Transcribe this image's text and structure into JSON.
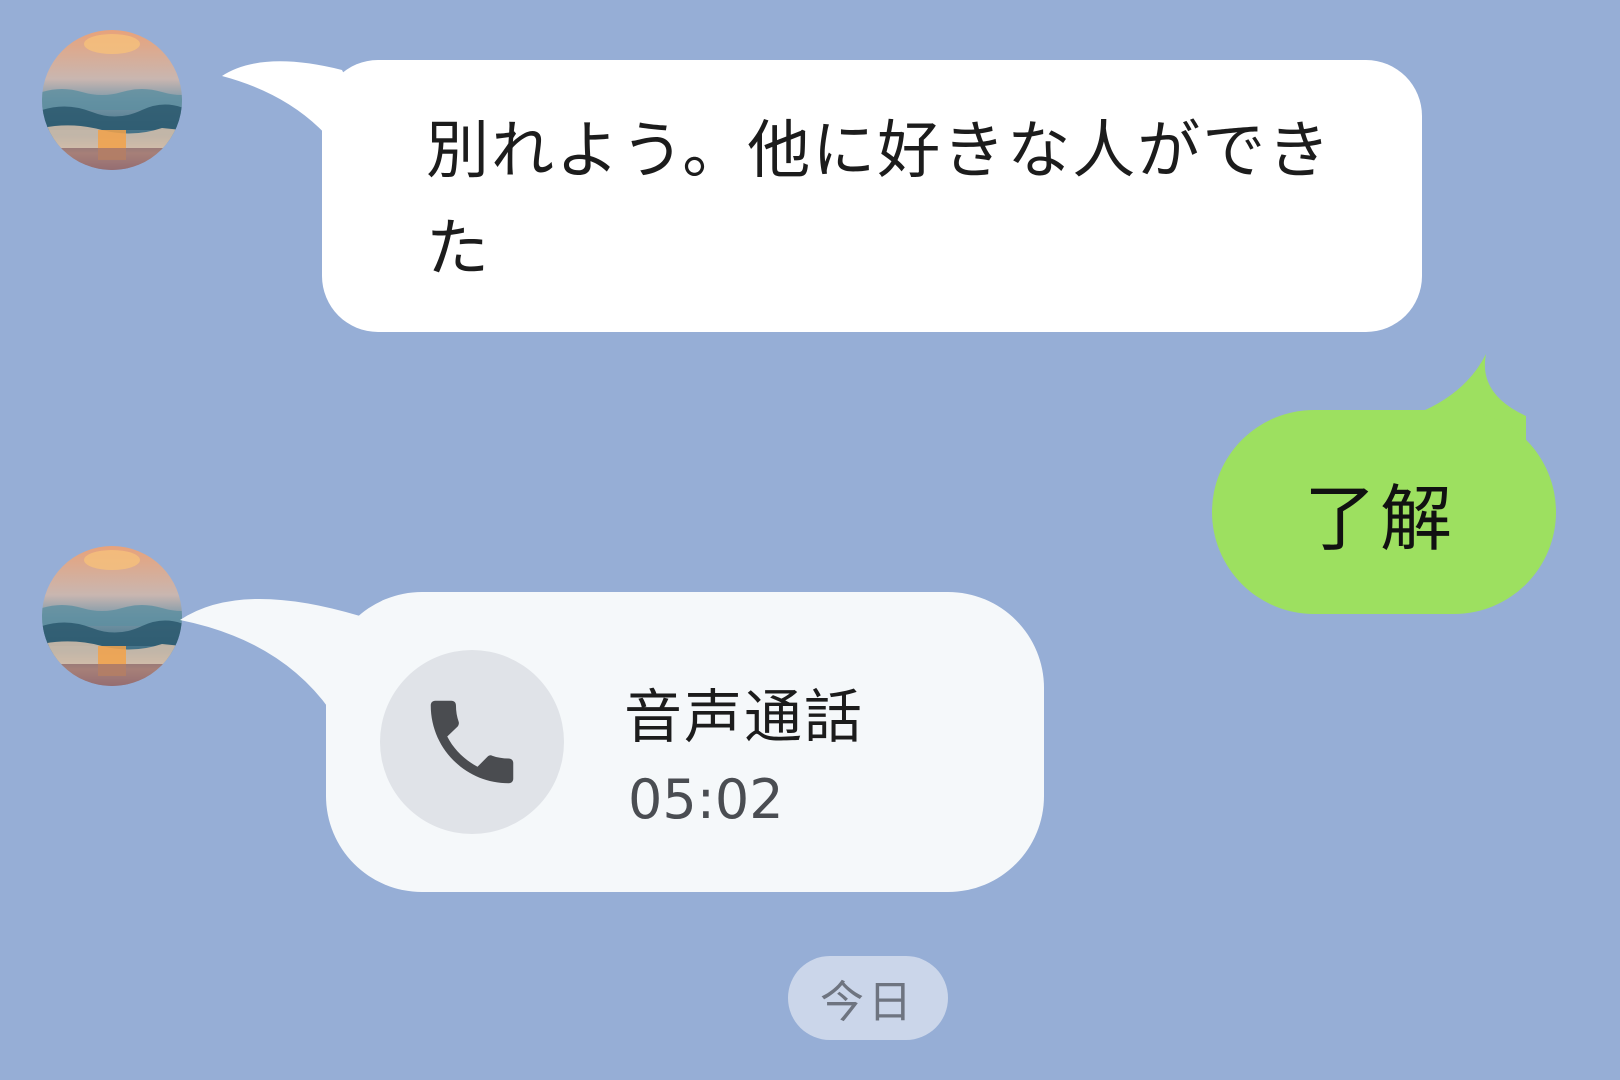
{
  "messages": [
    {
      "sender": "other",
      "avatar": "sunset-sea-avatar",
      "text": "別れよう。他に好きな人ができた"
    },
    {
      "sender": "me",
      "text": "了解"
    },
    {
      "sender": "other",
      "avatar": "sunset-sea-avatar",
      "type": "call",
      "icon": "phone-icon",
      "title": "音声通話",
      "duration": "05:02"
    }
  ],
  "date_separator": "今日",
  "colors": {
    "background": "#96aed6",
    "incoming_bubble": "#ffffff",
    "outgoing_bubble": "#9de060",
    "call_bubble": "#f5f8fa",
    "call_icon_bg": "#e0e3e8",
    "date_pill": "#cbd6ea"
  }
}
